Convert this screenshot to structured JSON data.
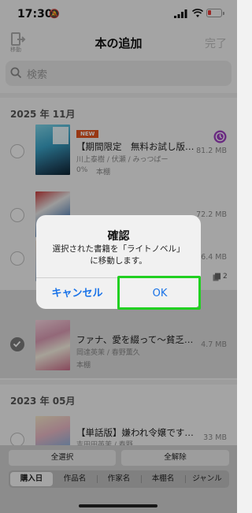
{
  "status_bar": {
    "time": "17:30"
  },
  "nav": {
    "move_label": "移動",
    "title": "本の追加",
    "done": "完了"
  },
  "search": {
    "placeholder": "検索"
  },
  "sections": [
    {
      "label": "2025 年 11月"
    },
    {
      "label": "2023 年 05月"
    }
  ],
  "books": [
    {
      "badge": "NEW",
      "title": "【期間限定　無料お試し版…",
      "author": "川上泰樹 / 伏瀬 / みっつばー",
      "progress": "0%",
      "shelf": "本棚",
      "size": "81.2 MB",
      "selected": false
    },
    {
      "size": "72.2 MB",
      "selected": false
    },
    {
      "size": "6.4 MB",
      "count": "2",
      "selected": false
    },
    {
      "title": "ファナ、愛を綴って〜貧乏…",
      "author": "岡達英茉 / 春野薫久",
      "shelf": "本棚",
      "size": "4.7 MB",
      "selected": true
    },
    {
      "title": "【単話版】嫌われ令嬢です…",
      "author": "吉田田英茉 / 春野…",
      "size": "33 MB",
      "selected": false
    }
  ],
  "dialog": {
    "title": "確認",
    "message_line1": "選択された書籍を「ライトノベル」",
    "message_line2": "に移動します。",
    "cancel": "キャンセル",
    "ok": "OK"
  },
  "bottom": {
    "select_all": "全選択",
    "deselect_all": "全解除",
    "sort_tabs": [
      "購入日",
      "作品名",
      "作家名",
      "本棚名",
      "ジャンル"
    ],
    "selected_tab": "購入日"
  },
  "colors": {
    "accent_blue": "#1a73e8",
    "highlight_green": "#21d021",
    "new_badge": "#e0531e",
    "battery_low": "#e53935",
    "clock_badge": "#9c3fbf"
  }
}
